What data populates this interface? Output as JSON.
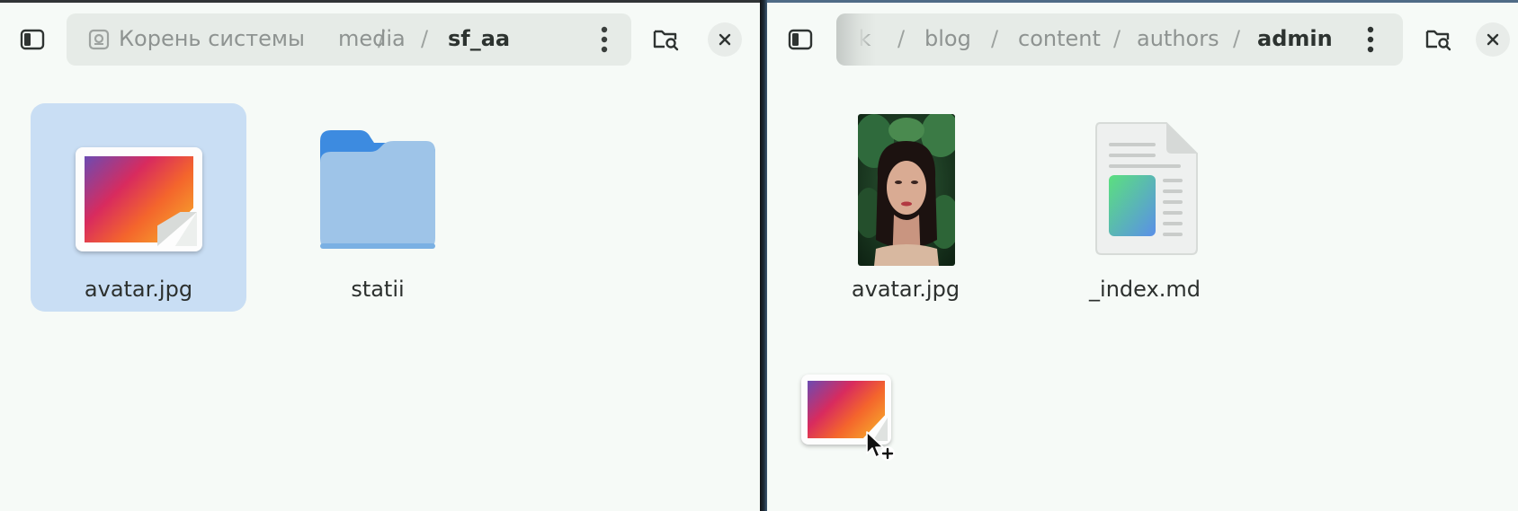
{
  "left_pane": {
    "breadcrumb": [
      "Корень системы",
      "media",
      "sf_aa"
    ],
    "separator": "/",
    "items": [
      {
        "name": "avatar.jpg",
        "type": "image",
        "selected": true
      },
      {
        "name": "statii",
        "type": "folder",
        "selected": false
      }
    ]
  },
  "right_pane": {
    "breadcrumb": [
      "ork",
      "blog",
      "content",
      "authors",
      "admin"
    ],
    "separator": "/",
    "items": [
      {
        "name": "avatar.jpg",
        "type": "photo",
        "selected": false
      },
      {
        "name": "_index.md",
        "type": "markdown",
        "selected": false
      }
    ]
  },
  "icons": {
    "sidebar_toggle": "sidebar-toggle-icon",
    "drive": "drive-icon",
    "menu": "kebab-menu-icon",
    "search_folder": "folder-search-icon",
    "close": "close-icon",
    "cursor": "copy-cursor-icon"
  },
  "colors": {
    "selection": "#c9def4",
    "window_bg": "#f6faf7",
    "pathbar_bg": "#e6ebe7",
    "folder_front": "#9ec4e8",
    "folder_back": "#3d8be0"
  }
}
